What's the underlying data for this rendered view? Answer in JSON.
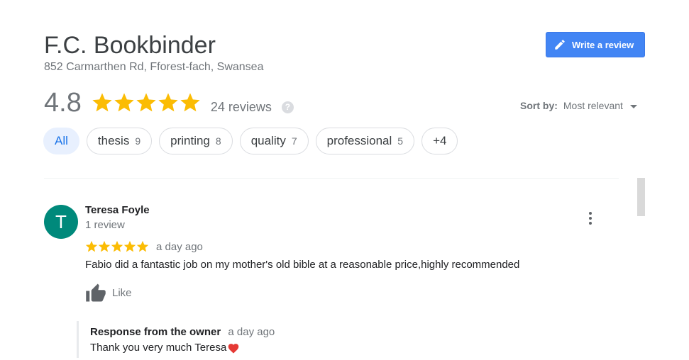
{
  "business": {
    "name": "F.C. Bookbinder",
    "address": "852 Carmarthen Rd, Fforest-fach, Swansea"
  },
  "write_review": {
    "label": "Write a review",
    "icon": "pencil-icon",
    "color": "#4285f4"
  },
  "rating": {
    "value": "4.8",
    "stars": 5,
    "reviews_label": "24 reviews",
    "help_icon": "?",
    "star_color": "#fbbc04"
  },
  "sort": {
    "label": "Sort by:",
    "value": "Most relevant"
  },
  "chips": [
    {
      "label": "All",
      "count": "",
      "active": true
    },
    {
      "label": "thesis",
      "count": "9",
      "active": false
    },
    {
      "label": "printing",
      "count": "8",
      "active": false
    },
    {
      "label": "quality",
      "count": "7",
      "active": false
    },
    {
      "label": "professional",
      "count": "5",
      "active": false
    },
    {
      "label": "+4",
      "count": "",
      "active": false
    }
  ],
  "review": {
    "avatar_letter": "T",
    "avatar_color": "#00897b",
    "author": "Teresa Foyle",
    "author_meta": "1 review",
    "stars": 5,
    "date": "a day ago",
    "text": "Fabio did a fantastic job on my mother's old bible at a reasonable price,highly recommended",
    "like_label": "Like",
    "owner_response": {
      "title": "Response from the owner",
      "date": "a day ago",
      "text": "Thank you very much Teresa",
      "emoji_icon": "red-heart-icon"
    }
  }
}
